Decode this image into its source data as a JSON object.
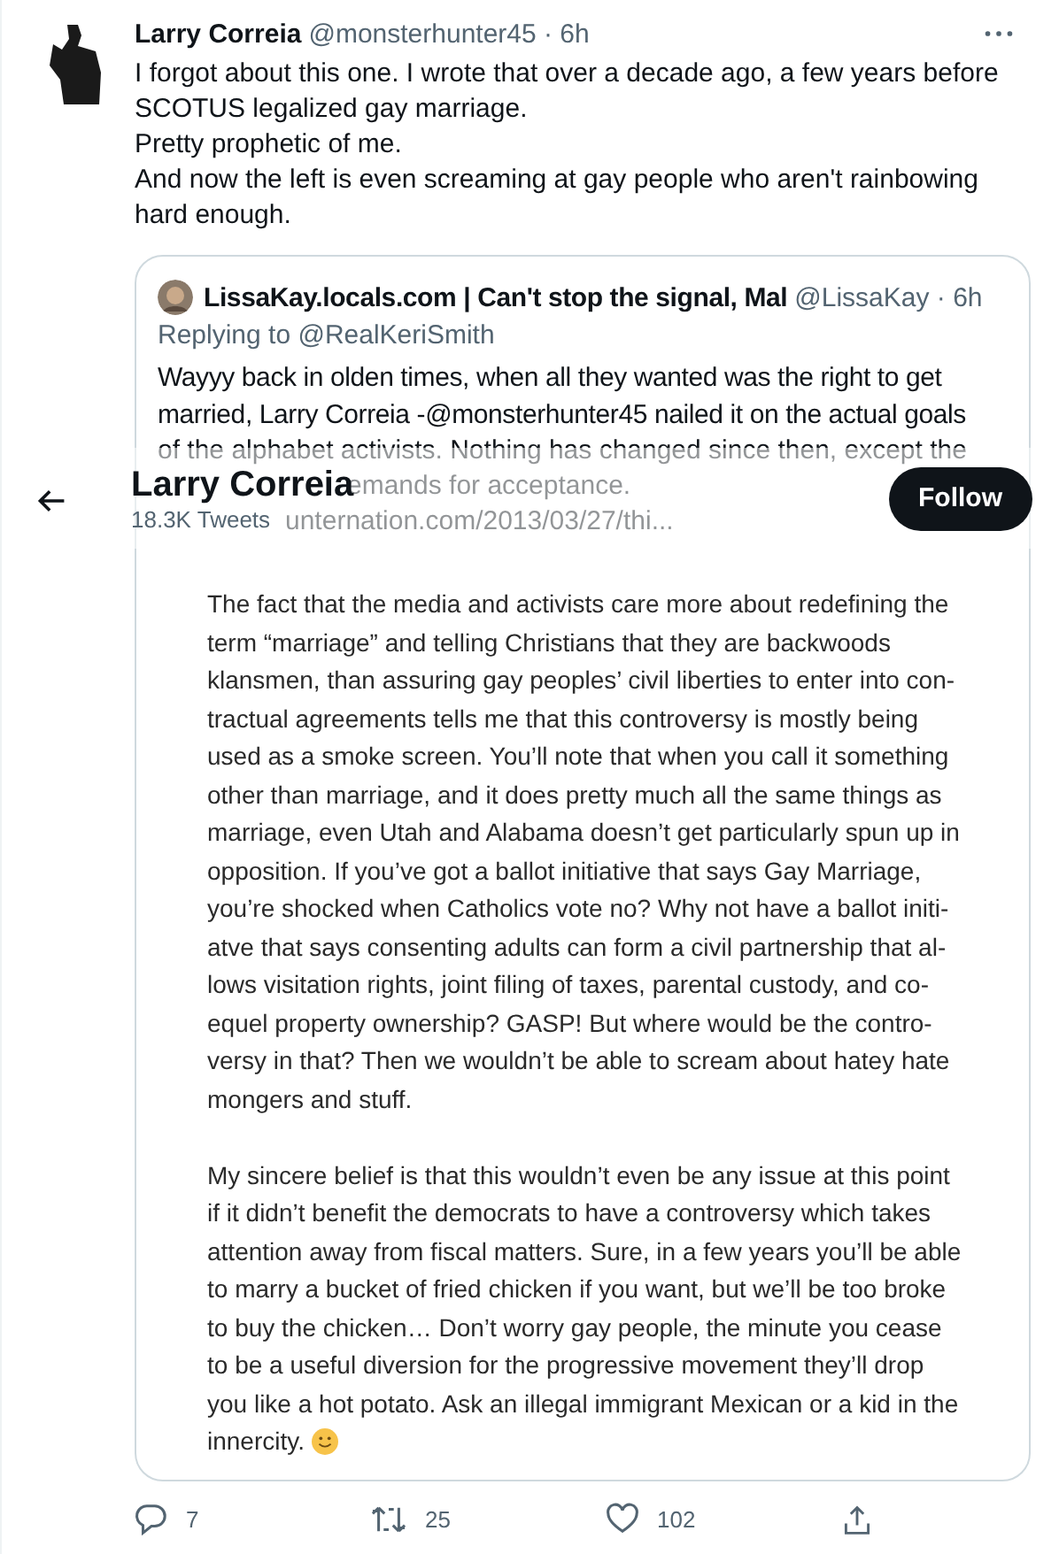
{
  "tweet": {
    "author": "Larry Correia",
    "meta": "@monsterhunter45 · 6h",
    "text_lines": [
      "I forgot about this one. I wrote that over a decade ago, a few years before",
      "SCOTUS legalized gay marriage.",
      "Pretty prophetic of me.",
      "And now the left is even screaming at gay people who aren't rainbowing",
      "hard enough."
    ],
    "quote": {
      "author": "LissaKay.locals.com | Can't stop the signal, Mal",
      "meta": "@LissaKay · 6h",
      "replying_to": "Replying to @RealKeriSmith",
      "text_lines": [
        "Wayyy back in olden times, when all they wanted was the right to get",
        "married, Larry Correia -@monsterhunter45 nailed it on the actual goals"
      ],
      "faded_lines": [
        "of the alphabet activists. Nothing has changed since then, except the",
        "emands for acceptance.",
        "unternation.com/2013/03/27/thi..."
      ],
      "article": {
        "paragraphs": [
          [
            "The fact that the media and activists care more about redefining the",
            "term “marriage” and telling Christians that they are backwoods",
            "klansmen, than assuring gay peoples’ civil liberties to enter into con-",
            "tractual agreements tells me that this controversy is mostly being",
            "used as a smoke screen. You’ll note that when you call it something",
            "other than marriage, and it does pretty much all the same things as",
            "marriage, even Utah and Alabama doesn’t get particularly spun up in",
            "opposition. If you’ve got a ballot initiative that says Gay Marriage,",
            "you’re shocked when Catholics vote no? Why not have a ballot initi-",
            "atve that says consenting adults can form a civil partnership that al-",
            "lows visitation rights, joint filing of taxes, parental custody, and co-",
            "equel property ownership? GASP! But where would be the contro-",
            "versy in that? Then we wouldn’t be able to scream about hatey hate",
            "mongers and stuff."
          ],
          [
            "My sincere belief is that this wouldn’t even be any issue at this point",
            "if it didn’t benefit the democrats to have a controversy which takes",
            "attention away from fiscal matters. Sure, in a few years you’ll be able",
            "to marry a bucket of fried chicken if you want, but we’ll be too broke",
            "to buy the chicken… Don’t worry gay people, the minute you cease",
            "to be a useful diversion for the progressive movement they’ll drop",
            "you like a hot potato. Ask an illegal immigrant Mexican or a kid in the",
            "innercity."
          ]
        ]
      }
    },
    "actions": [
      {
        "kind": "reply",
        "count": "7"
      },
      {
        "kind": "retweet",
        "count": "25"
      },
      {
        "kind": "like",
        "count": "102"
      },
      {
        "kind": "share"
      }
    ]
  },
  "sticky_header": {
    "title": "Larry Correia",
    "subtitle": "18.3K Tweets",
    "follow": "Follow"
  }
}
